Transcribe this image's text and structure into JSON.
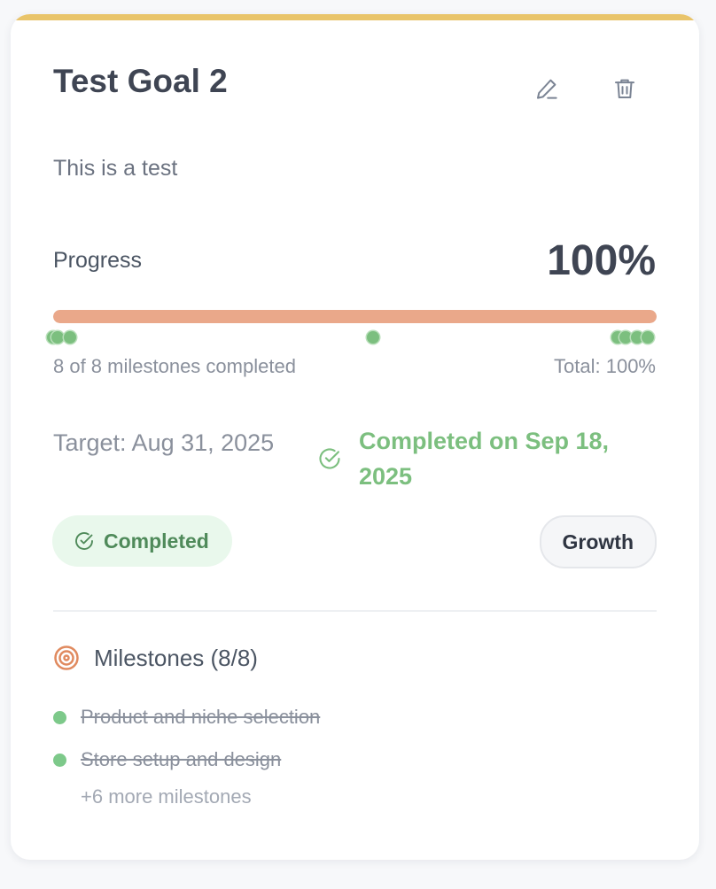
{
  "goal": {
    "title": "Test Goal 2",
    "description": "This is a test",
    "accent_color": "#e9c46a"
  },
  "actions": {
    "edit_icon": "pencil-icon",
    "delete_icon": "trash-icon"
  },
  "progress": {
    "label": "Progress",
    "value_text": "100%",
    "percent": 100,
    "bar_color": "#eaa88a",
    "milestone_dot_fractions": [
      0,
      0.008,
      0.028,
      0.53,
      0.935,
      0.948,
      0.967,
      0.985
    ],
    "dot_color": "#7cbf7f",
    "milestones_completed_text": "8 of 8 milestones completed",
    "total_text": "Total: 100%"
  },
  "dates": {
    "target_text": "Target: Aug 31, 2025",
    "completed_text": "Completed on Sep 18, 2025",
    "completed_icon": "check-circle-icon",
    "completed_color": "#7cbf7f"
  },
  "status": {
    "label": "Completed",
    "icon": "check-circle-icon",
    "color": "#4f8a5a"
  },
  "category": {
    "label": "Growth"
  },
  "milestones": {
    "title": "Milestones (8/8)",
    "icon": "target-icon",
    "items": [
      {
        "label": "Product and niche selection",
        "done": true
      },
      {
        "label": "Store setup and design",
        "done": true
      }
    ],
    "more_text": "+6 more milestones"
  }
}
